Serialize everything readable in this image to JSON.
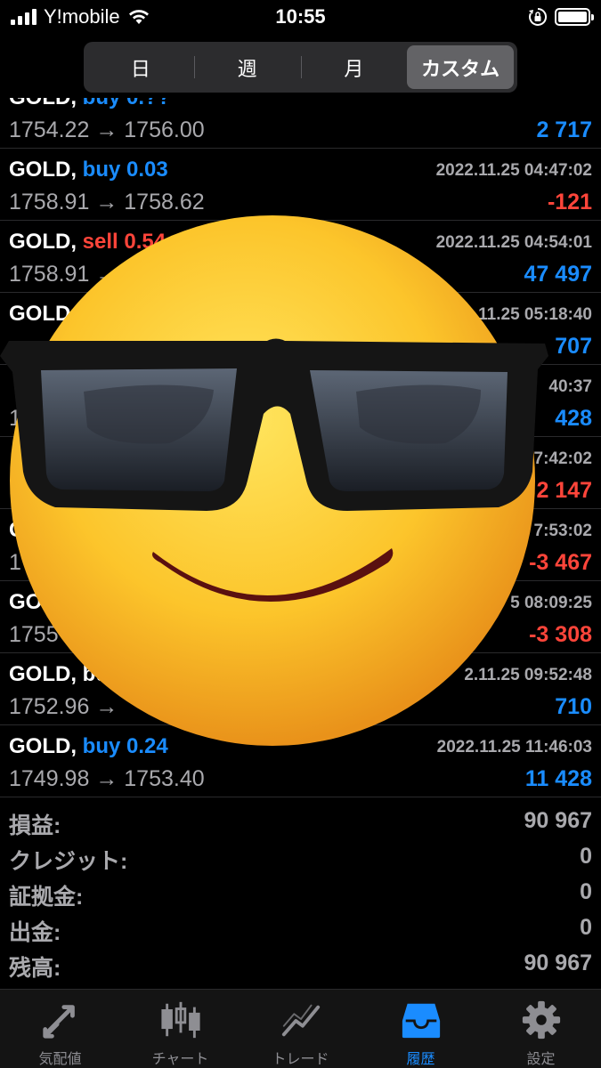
{
  "status_bar": {
    "carrier": "Y!mobile",
    "time": "10:55"
  },
  "segments": [
    {
      "label": "日",
      "active": false
    },
    {
      "label": "週",
      "active": false
    },
    {
      "label": "月",
      "active": false
    },
    {
      "label": "カスタム",
      "active": true
    }
  ],
  "trades": [
    {
      "symbol": "GOLD,",
      "side": "buy",
      "volume": "0.??",
      "time": "",
      "prices": "1754.22 → 1756.00",
      "profit": "2 717",
      "sign": "pos"
    },
    {
      "symbol": "GOLD,",
      "side": "buy",
      "volume": "0.03",
      "time": "2022.11.25 04:47:02",
      "prices": "1758.91 → 1758.62",
      "profit": "-121",
      "sign": "neg"
    },
    {
      "symbol": "GOLD,",
      "side": "sell",
      "volume": "0.54",
      "time": "2022.11.25 04:54:01",
      "prices": "1758.91 → ",
      "profit": "47 497",
      "sign": "pos"
    },
    {
      "symbol": "GOLD,",
      "side": "",
      "volume": "",
      "time": "11.25 05:18:40",
      "prices": "",
      "profit": "707",
      "sign": "pos"
    },
    {
      "symbol": "",
      "side": "",
      "volume": "",
      "time": "40:37",
      "prices": "1",
      "profit": "428",
      "sign": "pos"
    },
    {
      "symbol": "",
      "side": "",
      "volume": "",
      "time": "7:42:02",
      "prices": "",
      "profit": "2 147",
      "sign": "neg"
    },
    {
      "symbol": "G",
      "side": "",
      "volume": "",
      "time": "7:53:02",
      "prices": "1",
      "profit": "-3 467",
      "sign": "neg"
    },
    {
      "symbol": "GOLD,",
      "side": "",
      "volume": "",
      "time": "5 08:09:25",
      "prices": "1755",
      "profit": "-3 308",
      "sign": "neg"
    },
    {
      "symbol": "GOLD,",
      "side": "bu",
      "volume": "",
      "time": "2.11.25 09:52:48",
      "prices": "1752.96 →",
      "profit": "710",
      "sign": "pos"
    },
    {
      "symbol": "GOLD,",
      "side": "buy",
      "volume": "0.24",
      "time": "2022.11.25 11:46:03",
      "prices": "1749.98 → 1753.40",
      "profit": "11 428",
      "sign": "pos"
    }
  ],
  "summary": [
    {
      "label": "損益:",
      "value": "90 967"
    },
    {
      "label": "クレジット:",
      "value": "0"
    },
    {
      "label": "証拠金:",
      "value": "0"
    },
    {
      "label": "出金:",
      "value": "0"
    },
    {
      "label": "残高:",
      "value": "90 967"
    }
  ],
  "tabs": [
    {
      "label": "気配値",
      "icon": "quotes-arrows-icon",
      "active": false
    },
    {
      "label": "チャート",
      "icon": "candlestick-icon",
      "active": false
    },
    {
      "label": "トレード",
      "icon": "trade-chart-icon",
      "active": false
    },
    {
      "label": "履歴",
      "icon": "inbox-tray-icon",
      "active": true
    },
    {
      "label": "設定",
      "icon": "gear-icon",
      "active": false
    }
  ],
  "colors": {
    "buy": "#1a8cff",
    "sell": "#ff453a",
    "muted": "#a9a9ad",
    "tab_active": "#1a8cff"
  },
  "overlay": {
    "icon": "smiling-face-with-sunglasses-emoji"
  }
}
